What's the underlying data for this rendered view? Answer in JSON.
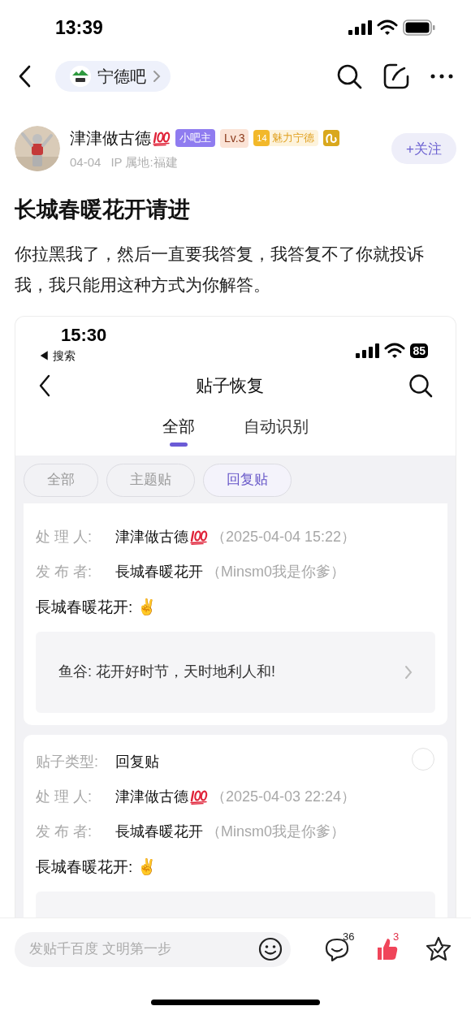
{
  "status_bar": {
    "time": "13:39"
  },
  "nav": {
    "forum": "宁德吧"
  },
  "author": {
    "name": "津津做古德",
    "hundred_emoji": true,
    "date": "04-04",
    "ip": "IP 属地:福建",
    "follow": "+关注",
    "badges": [
      {
        "kind": "role",
        "text": "小吧主"
      },
      {
        "kind": "level",
        "text": "Lv.3"
      },
      {
        "kind": "fan",
        "number": "14",
        "text": "魅力宁德"
      },
      {
        "kind": "zodiac"
      }
    ]
  },
  "post": {
    "title": "长城春暖花开请进",
    "body": "你拉黑我了，然后一直要我答复，我答复不了你就投诉我，我只能用这种方式为你解答。"
  },
  "screenshot": {
    "time": "15:30",
    "back_app": "◀ 搜索",
    "battery": "85",
    "title": "贴子恢复",
    "tabs": [
      {
        "label": "全部",
        "selected": true
      },
      {
        "label": "自动识别",
        "selected": false
      }
    ],
    "filters": [
      {
        "label": "全部",
        "selected": false
      },
      {
        "label": "主题贴",
        "selected": false
      },
      {
        "label": "回复贴",
        "selected": true
      }
    ],
    "records": [
      {
        "fields": [
          {
            "label": "处 理 人:",
            "value": "津津做古德",
            "hundred_emoji": true,
            "note": "（2025-04-04 15:22）"
          },
          {
            "label": "发 布 者:",
            "value": "長城春暖花开",
            "note": "（Minsm0我是你爹）"
          }
        ],
        "content": "長城春暖花开: ✌",
        "quote": "鱼谷: 花开好时节，天时地利人和!"
      },
      {
        "checked": false,
        "fields": [
          {
            "label": "贴子类型:",
            "value": "回复贴"
          },
          {
            "label": "处 理 人:",
            "value": "津津做古德",
            "hundred_emoji": true,
            "note": "（2025-04-03 22:24）"
          },
          {
            "label": "发 布 者:",
            "value": "長城春暖花开",
            "note": "（Minsm0我是你爹）"
          }
        ],
        "content": "長城春暖花开: ✌"
      }
    ]
  },
  "bottom_bar": {
    "placeholder": "发贴千百度 文明第一步",
    "comments": "36",
    "likes": "3"
  }
}
